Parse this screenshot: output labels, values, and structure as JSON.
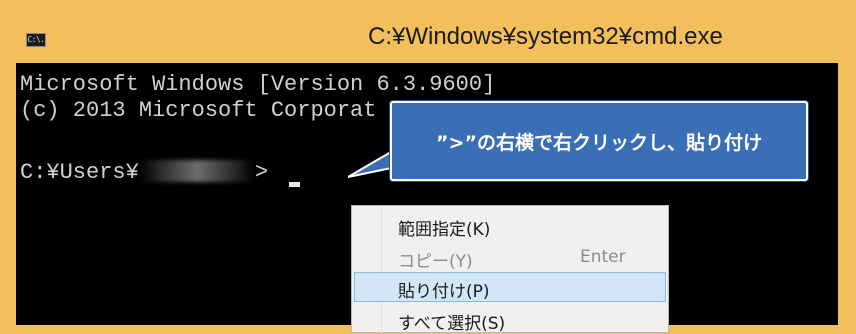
{
  "window": {
    "title": "C:¥Windows¥system32¥cmd.exe",
    "icon_text": "C:\\."
  },
  "console": {
    "line1": "Microsoft Windows [Version 6.3.9600]",
    "line2": "(c) 2013 Microsoft Corporat",
    "prompt_prefix": "C:¥Users¥",
    "prompt_suffix": ">"
  },
  "callout": {
    "text": "”>”の右横で右クリックし、貼り付け"
  },
  "context_menu": {
    "items": [
      {
        "label": "範囲指定(K)",
        "shortcut": "",
        "state": "normal"
      },
      {
        "label": "コピー(Y)",
        "shortcut": "Enter",
        "state": "disabled"
      },
      {
        "label": "貼り付け(P)",
        "shortcut": "",
        "state": "selected"
      },
      {
        "label": "すべて選択(S)",
        "shortcut": "",
        "state": "normal"
      }
    ]
  },
  "colors": {
    "frame": "#f3bf5a",
    "console_bg": "#000000",
    "callout_bg": "#3a6fb5",
    "menu_selected": "#d3e6f7"
  }
}
